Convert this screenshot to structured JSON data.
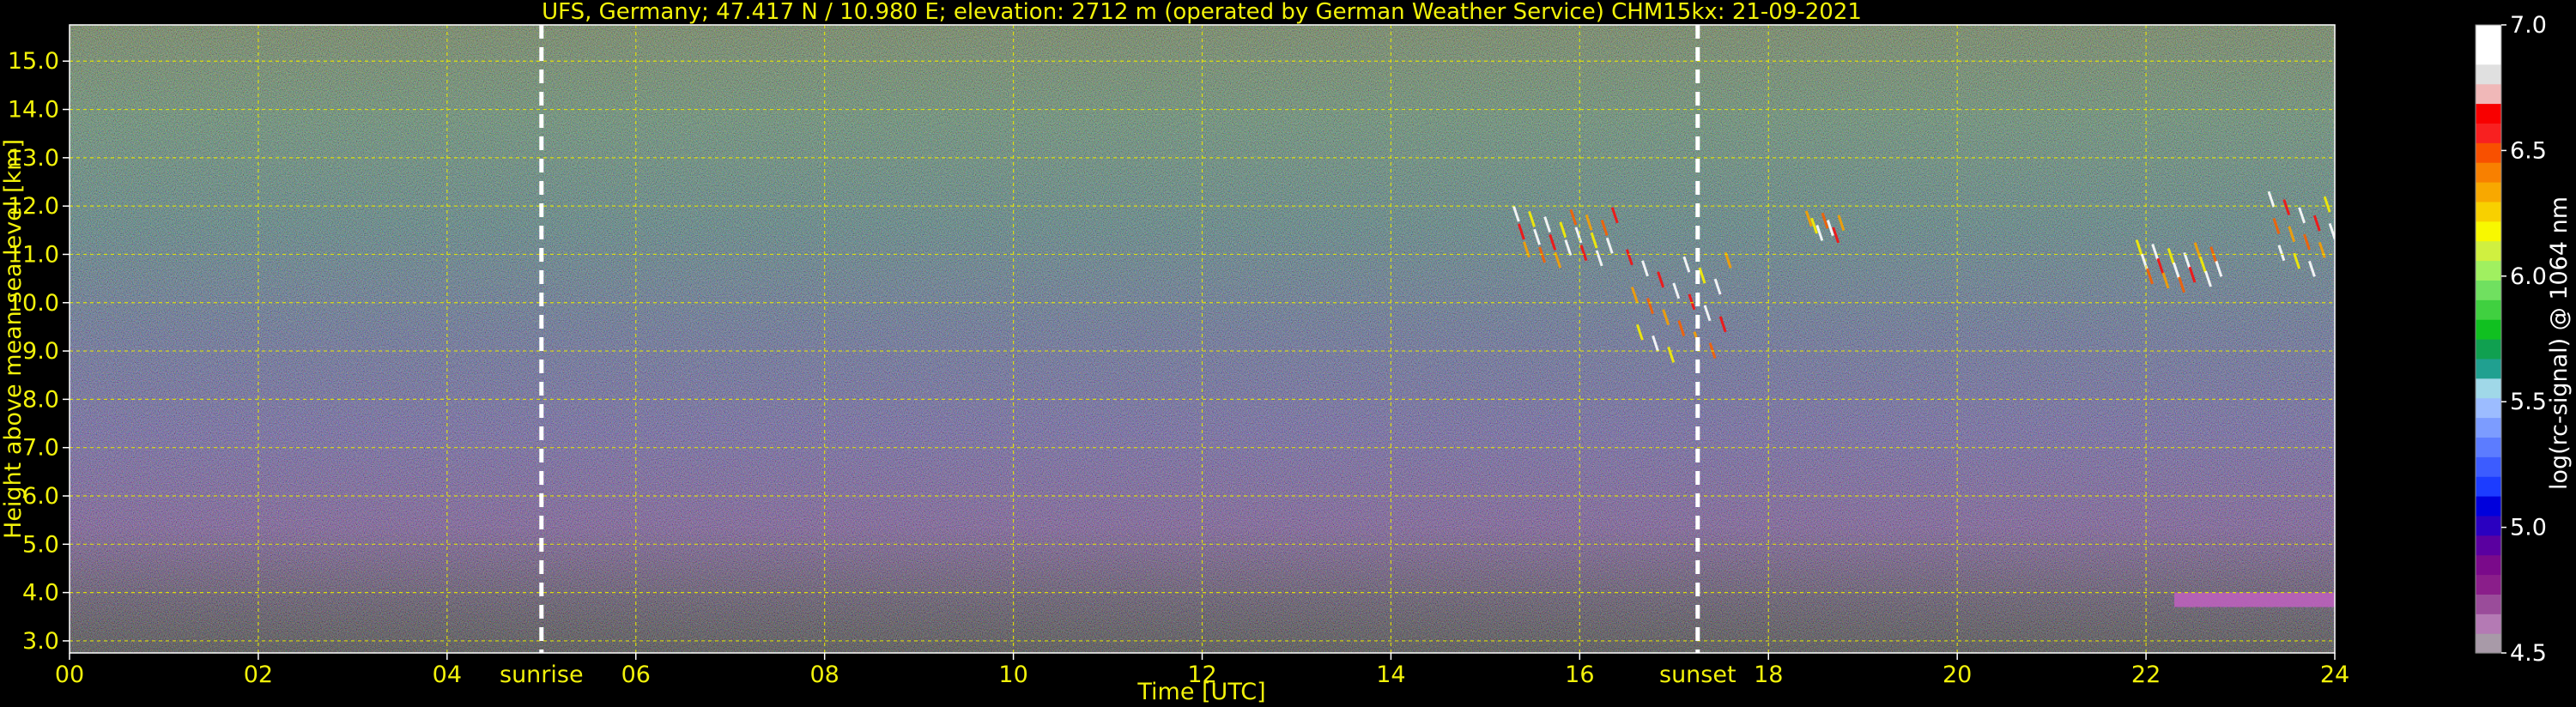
{
  "chart_data": {
    "type": "heatmap",
    "title": "UFS, Germany; 47.417 N / 10.980 E; elevation: 2712 m  (operated by German Weather Service)    CHM15kx: 21-09-2021",
    "xlabel": "Time [UTC]",
    "ylabel": "Height above mean sea level [km]",
    "xlim": [
      0,
      24
    ],
    "ylim": [
      2.75,
      15.75
    ],
    "x_ticks": [
      "00",
      "02",
      "04",
      "06",
      "08",
      "10",
      "12",
      "14",
      "16",
      "18",
      "20",
      "22",
      "24"
    ],
    "y_ticks": [
      "3.0",
      "4.0",
      "5.0",
      "6.0",
      "7.0",
      "8.0",
      "9.0",
      "10.0",
      "11.0",
      "12.0",
      "13.0",
      "14.0",
      "15.0"
    ],
    "grid": true,
    "annotations": [
      {
        "label": "sunrise",
        "x": 5.0
      },
      {
        "label": "sunset",
        "x": 17.25
      }
    ],
    "colorbar": {
      "label": "log(rc-signal) @ 1064 nm",
      "range": [
        4.5,
        7.0
      ],
      "ticks": [
        "4.5",
        "5.0",
        "5.5",
        "6.0",
        "6.5",
        "7.0"
      ],
      "colors": [
        "#a89aa8",
        "#b47ab4",
        "#9a4c9a",
        "#8a1e8a",
        "#7a0a8a",
        "#5a00a0",
        "#2a00c0",
        "#0000dc",
        "#1c3cff",
        "#3c5cff",
        "#5c7cff",
        "#7c9cff",
        "#9cbcff",
        "#a0d8e8",
        "#20a090",
        "#10a050",
        "#10c020",
        "#40d040",
        "#70e060",
        "#a0f060",
        "#d0f040",
        "#f8f800",
        "#f8d000",
        "#f8a800",
        "#f88000",
        "#f85000",
        "#f82020",
        "#f80000",
        "#f0b8b8",
        "#e0e0e0",
        "#ffffff",
        "#ffffff"
      ]
    },
    "features": [
      {
        "type": "cirrus",
        "x_start": 15.3,
        "x_end": 16.4,
        "y_start": 11.0,
        "y_end": 12.0
      },
      {
        "type": "cirrus",
        "x_start": 16.5,
        "x_end": 17.6,
        "y_start": 9.0,
        "y_end": 11.1
      },
      {
        "type": "cirrus",
        "x_start": 18.4,
        "x_end": 18.8,
        "y_start": 11.5,
        "y_end": 11.9
      },
      {
        "type": "cirrus",
        "x_start": 21.9,
        "x_end": 22.8,
        "y_start": 10.5,
        "y_end": 11.3
      },
      {
        "type": "cirrus",
        "x_start": 23.3,
        "x_end": 24.0,
        "y_start": 10.8,
        "y_end": 12.3
      },
      {
        "type": "low_layer",
        "x_start": 22.3,
        "x_end": 24.0,
        "y_start": 3.7,
        "y_end": 4.0
      }
    ]
  }
}
